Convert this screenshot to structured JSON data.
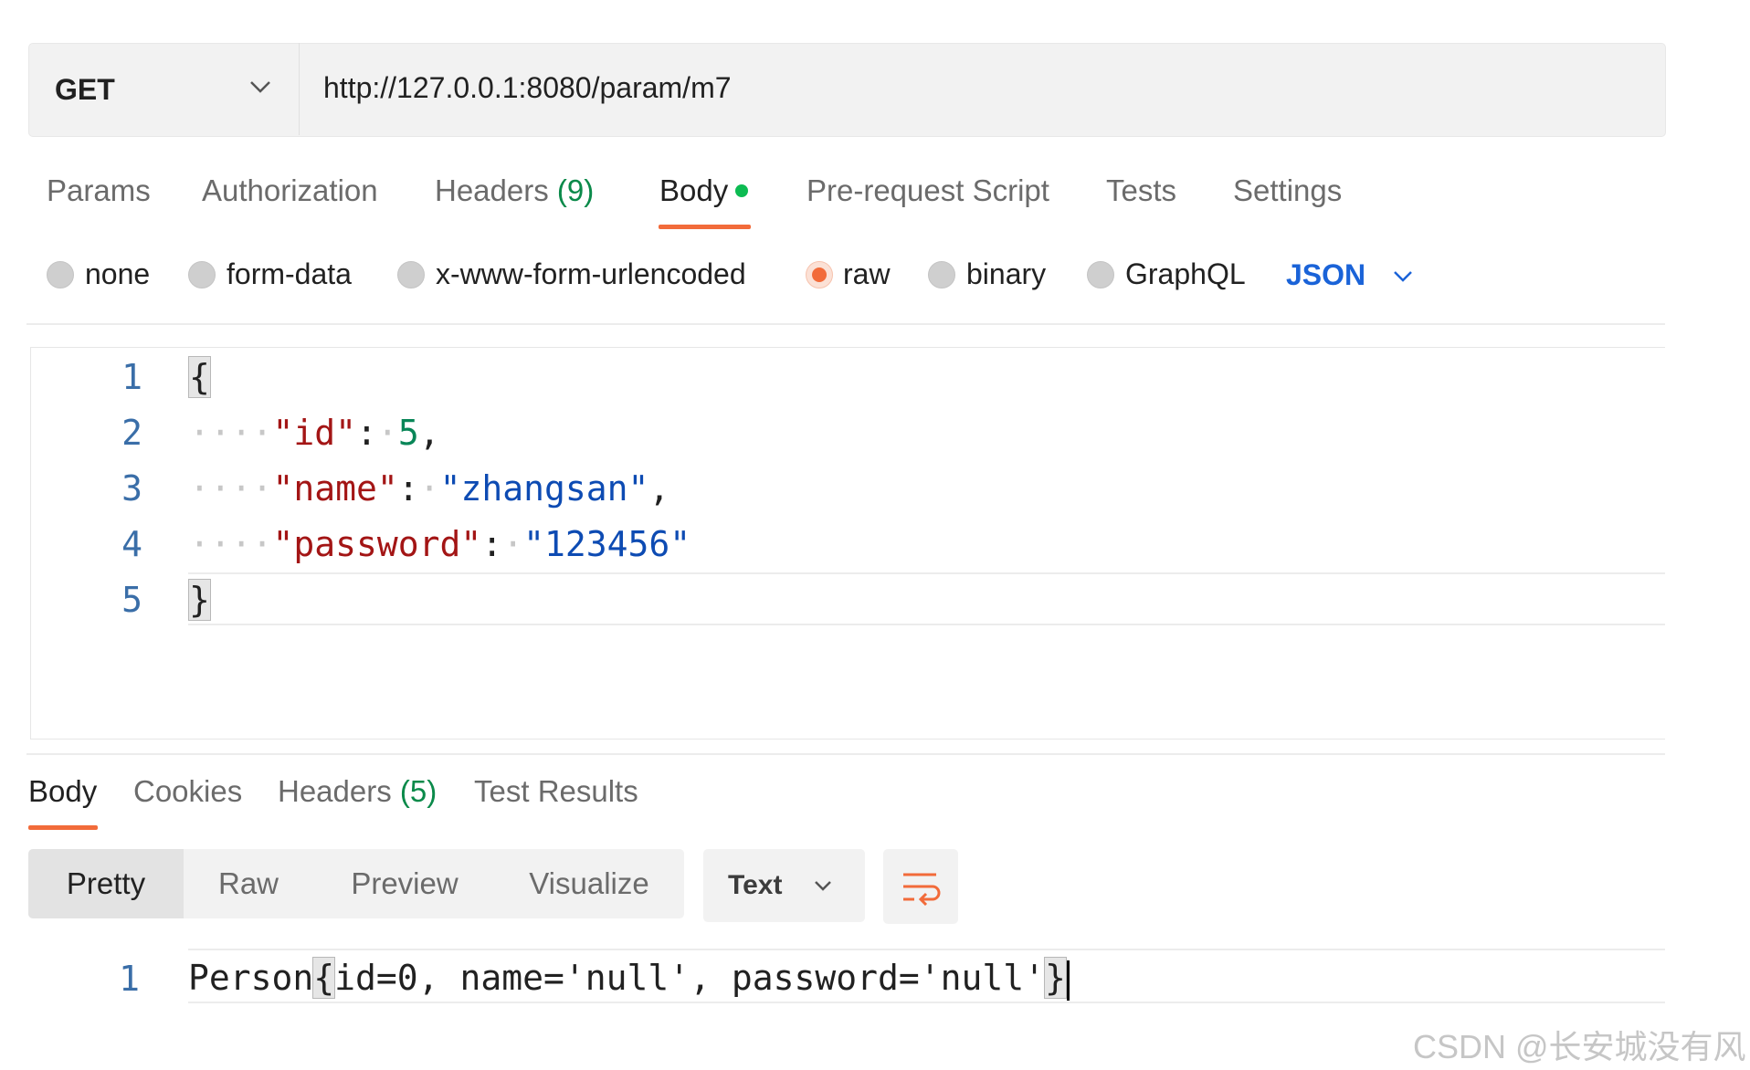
{
  "request": {
    "method": "GET",
    "url": "http://127.0.0.1:8080/param/m7",
    "tabs": {
      "params": "Params",
      "authorization": "Authorization",
      "headers": "Headers",
      "headers_count": "(9)",
      "body": "Body",
      "prerequest": "Pre-request Script",
      "tests": "Tests",
      "settings": "Settings"
    },
    "body_types": {
      "none": "none",
      "form_data": "form-data",
      "urlencoded": "x-www-form-urlencoded",
      "raw": "raw",
      "binary": "binary",
      "graphql": "GraphQL"
    },
    "selected_body_type": "raw",
    "raw_format": "JSON",
    "editor": {
      "line_numbers": [
        "1",
        "2",
        "3",
        "4",
        "5"
      ],
      "open_brace": "{",
      "close_brace": "}",
      "indent": "····",
      "colon": ":",
      "comma": ",",
      "key_id": "\"id\"",
      "val_id": "5",
      "key_name": "\"name\"",
      "val_name": "\"zhangsan\"",
      "key_password": "\"password\"",
      "val_password": "\"123456\""
    }
  },
  "response": {
    "tabs": {
      "body": "Body",
      "cookies": "Cookies",
      "headers": "Headers",
      "headers_count": "(5)",
      "test_results": "Test Results"
    },
    "views": {
      "pretty": "Pretty",
      "raw": "Raw",
      "preview": "Preview",
      "visualize": "Visualize"
    },
    "format": "Text",
    "body": {
      "line_number": "1",
      "prefix": "Person",
      "open_brace": "{",
      "content": "id=0, name='null', password='null'",
      "close_brace": "}"
    }
  },
  "watermark": "CSDN @长安城没有风",
  "colors": {
    "accent": "#f26b3a",
    "json_blue": "#1a63d8",
    "count_green": "#0b8a4a",
    "key_red": "#a31515",
    "string_blue": "#0d4bb3"
  }
}
